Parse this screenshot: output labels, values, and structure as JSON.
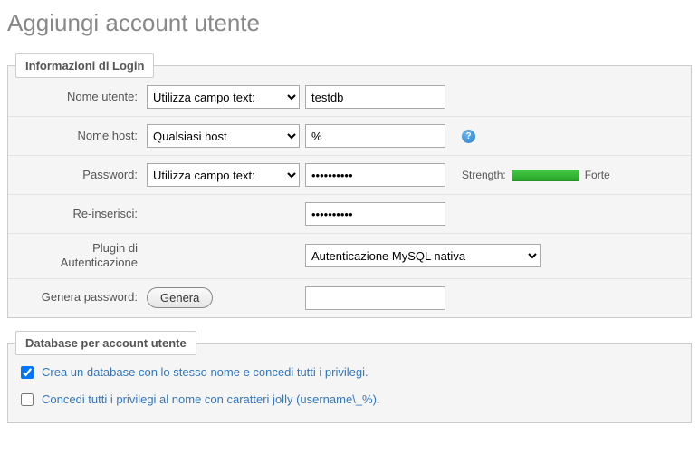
{
  "pageTitle": "Aggiungi account utente",
  "loginLegend": "Informazioni di Login",
  "fields": {
    "username": {
      "label": "Nome utente:",
      "selectValue": "Utilizza campo text:",
      "value": "testdb"
    },
    "hostname": {
      "label": "Nome host:",
      "selectValue": "Qualsiasi host",
      "value": "%"
    },
    "password": {
      "label": "Password:",
      "selectValue": "Utilizza campo text:",
      "value": "••••••••••",
      "strengthLabel": "Strength:",
      "strengthValue": "Forte"
    },
    "repassword": {
      "label": "Re-inserisci:",
      "value": "••••••••••"
    },
    "authPlugin": {
      "label": "Plugin di Autenticazione",
      "selectValue": "Autenticazione MySQL nativa"
    },
    "generate": {
      "label": "Genera password:",
      "button": "Genera",
      "value": ""
    }
  },
  "dbLegend": "Database per account utente",
  "dbOptions": {
    "createDb": {
      "label": "Crea un database con lo stesso nome e concedi tutti i privilegi.",
      "checked": true
    },
    "grantWildcard": {
      "label": "Concedi tutti i privilegi al nome con caratteri jolly (username\\_%).",
      "checked": false
    }
  }
}
